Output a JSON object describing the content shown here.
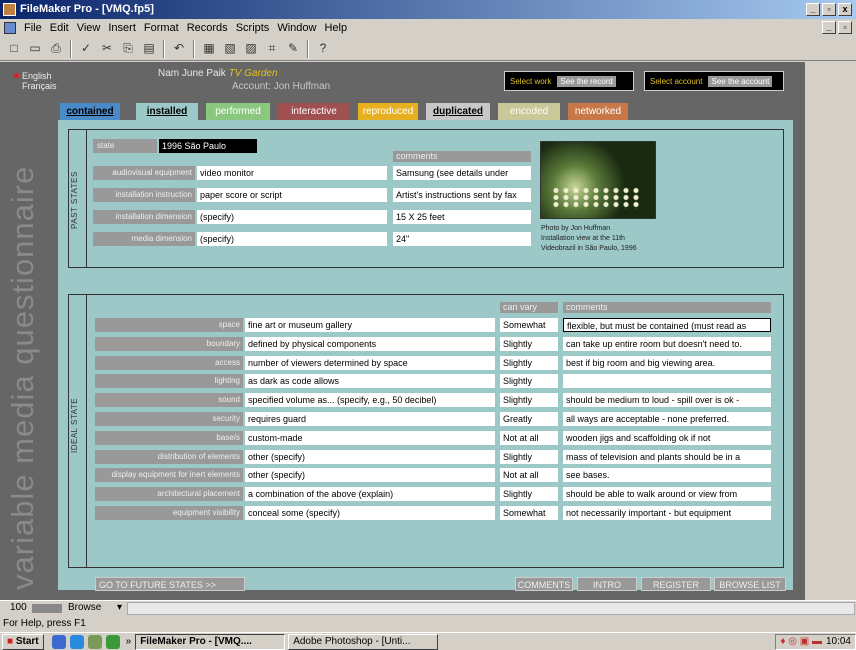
{
  "window": {
    "title": "FileMaker Pro - [VMQ.fp5]"
  },
  "menu": [
    "File",
    "Edit",
    "View",
    "Insert",
    "Format",
    "Records",
    "Scripts",
    "Window",
    "Help"
  ],
  "toolbar_icons": [
    "new-icon",
    "open-icon",
    "print-icon",
    "spell-icon",
    "cut-icon",
    "copy-icon",
    "paste-icon",
    "undo-icon",
    "sort-icon",
    "find-icon",
    "browse-icon",
    "layout-icon",
    "script-icon",
    "help-icon"
  ],
  "fm": {
    "side_title": "variable media questionnaire",
    "lang": [
      "English",
      "Français"
    ],
    "artist": "Nam June Paik ",
    "work": "TV Garden",
    "account": "Account: Jon Huffman",
    "select_work": "Select work",
    "see_record": "See the record",
    "select_account": "Select account",
    "see_account": "See the account",
    "tabs": [
      {
        "label": "contained",
        "bg": "#4a8ac8",
        "color": "#000"
      },
      {
        "label": "installed",
        "bg": "#9cc8c8",
        "color": "#000"
      },
      {
        "label": "performed",
        "bg": "#8ac880",
        "color": "#fff"
      },
      {
        "label": "interactive",
        "bg": "#a05050",
        "color": "#fff"
      },
      {
        "label": "reproduced",
        "bg": "#e8b020",
        "color": "#fff"
      },
      {
        "label": "duplicated",
        "bg": "#c8c8c8",
        "color": "#000"
      },
      {
        "label": "encoded",
        "bg": "#c8c898",
        "color": "#fff"
      },
      {
        "label": "networked",
        "bg": "#c87848",
        "color": "#fff"
      }
    ],
    "past": {
      "vlabel": "PAST STATES",
      "state_label": "state",
      "state_value": "1996 São Paulo",
      "comments_header": "comments",
      "rows": [
        {
          "label": "audiovisual equipment",
          "value": "video monitor",
          "comment": "Samsung (see details under"
        },
        {
          "label": "installation instruction",
          "value": "paper score or script",
          "comment": "Artist's instructions sent by fax"
        },
        {
          "label": "installation dimension",
          "value": " (specify)",
          "comment": "15 X 25 feet"
        },
        {
          "label": "media dimension",
          "value": " (specify)",
          "comment": "24\""
        }
      ],
      "caption": [
        "Photo by Jon Huffman",
        "Installation view at the 11th",
        "Videobrazil in São Paulo, 1996"
      ]
    },
    "ideal": {
      "vlabel": "IDEAL STATE",
      "can_vary_header": "can vary",
      "comments_header": "comments",
      "rows": [
        {
          "label": "space",
          "value": "fine art or museum gallery",
          "vary": "Somewhat",
          "comment": "flexible, but must be contained (must read as"
        },
        {
          "label": "boundary",
          "value": "defined by physical components",
          "vary": "Slightly",
          "comment": "can take up entire room but doesn't need to."
        },
        {
          "label": "access",
          "value": "number of viewers determined by space",
          "vary": "Slightly",
          "comment": "best if big room and big viewing area."
        },
        {
          "label": "lighting",
          "value": "as dark as code allows",
          "vary": "Slightly",
          "comment": ""
        },
        {
          "label": "sound",
          "value": "specified volume as... (specify, e.g., 50 decibel)",
          "vary": "Slightly",
          "comment": "should be medium to loud - spill over is ok -"
        },
        {
          "label": "security",
          "value": "requires guard",
          "vary": "Greatly",
          "comment": "all ways are acceptable - none preferred."
        },
        {
          "label": "base/s",
          "value": "custom-made",
          "vary": "Not at all",
          "comment": "wooden jigs and scaffolding ok if not"
        },
        {
          "label": "distribution of elements",
          "value": "other (specify)",
          "vary": "Slightly",
          "comment": "mass of television and plants should be in a"
        },
        {
          "label": "display equipment for inert elements",
          "value": "other (specify)",
          "vary": "Not at all",
          "comment": "see bases."
        },
        {
          "label": "architectural placement",
          "value": "a combination of the above (explain)",
          "vary": "Slightly",
          "comment": "should be able to walk around or view from"
        },
        {
          "label": "equipment visibility",
          "value": "conceal some (specify)",
          "vary": "Somewhat",
          "comment": "not necessarily important - but equipment"
        }
      ]
    },
    "go_future": "GO TO FUTURE STATES >>",
    "bottom_buttons": [
      "COMMENTS",
      "INTRO",
      "REGISTER",
      "BROWSE LIST"
    ]
  },
  "status": {
    "zoom": "100",
    "mode": "Browse",
    "help": "For Help, press F1"
  },
  "taskbar": {
    "start": "Start",
    "tasks": [
      "FileMaker Pro - [VMQ....",
      "Adobe Photoshop - [Unti..."
    ],
    "clock": "10:04"
  }
}
